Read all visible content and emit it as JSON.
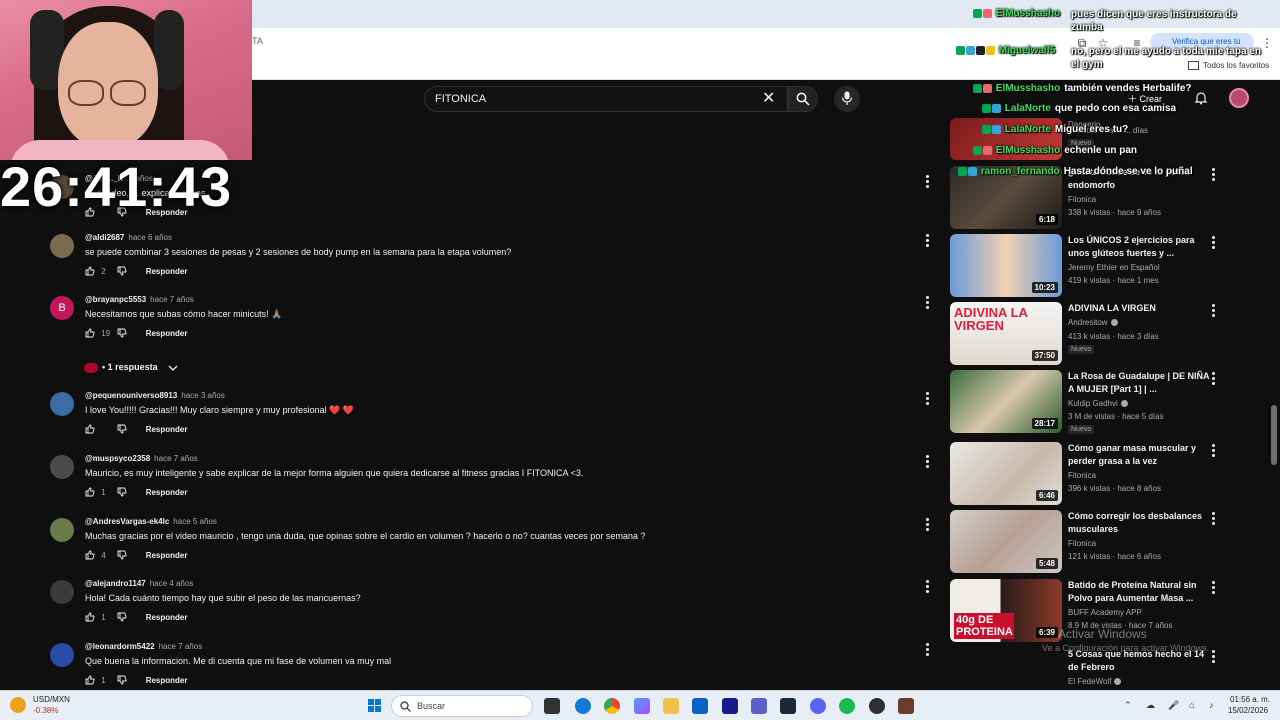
{
  "browser": {
    "address_fragment": "TA",
    "verify_label": "Verifica que eres tú",
    "bookmarks_label": "Todos los favoritos"
  },
  "youtube": {
    "search_value": "FITONICA",
    "create_label": "Crear"
  },
  "stream": {
    "timer": "26:41:43"
  },
  "comments": [
    {
      "user": "@Jos..._h",
      "time": "... años",
      "text": "Qué vídeo, ... explica ... cosas",
      "likes": "",
      "reply": "Responder"
    },
    {
      "user": "@aldi2687",
      "time": "hace 6 años",
      "text": "se puede combinar 3 sesiones de pesas y 2 sesiones de body pump en la semana para la etapa volumen?",
      "likes": "2",
      "reply": "Responder"
    },
    {
      "user": "@brayanpc5553",
      "time": "hace 7 años",
      "text": "Necesitamos que subas cómo hacer minicuts! 🙏🏽",
      "likes": "19",
      "reply": "Responder",
      "avatar_letter": "B"
    },
    {
      "user": "@pequenouniverso8913",
      "time": "hace 3 años",
      "text": "I love You!!!!! Gracias!!! Muy claro siempre y muy profesional ❤️ ❤️",
      "likes": "",
      "reply": "Responder"
    },
    {
      "user": "@muspsyco2358",
      "time": "hace 7 años",
      "text": "Mauricio, es muy inteligente y sabe explicar de la mejor forma alguien que quiera dedicarse al fitness gracias I FITONICA <3.",
      "likes": "1",
      "reply": "Responder"
    },
    {
      "user": "@AndresVargas-ek4lc",
      "time": "hace 5 años",
      "text": "Muchas gracias por el video mauricio , tengo una duda,  que opinas sobre el cardio en volumen ? hacerlo o no? cuantas veces por semana ?",
      "likes": "4",
      "reply": "Responder"
    },
    {
      "user": "@alejandro1147",
      "time": "hace 4 años",
      "text": "Hola! Cada cuánto tiempo hay que subir el peso de las mancuernas?",
      "likes": "1",
      "reply": "Responder"
    },
    {
      "user": "@leonardorm5422",
      "time": "hace 7 años",
      "text": "Que buena la informacion. Me di cuenta que mi fase de volumen va muy mal",
      "likes": "1",
      "reply": "Responder"
    }
  ],
  "replies_toggle": "• 1 respuesta",
  "sidebar_videos": [
    {
      "title": "Dangerio",
      "channel": "",
      "meta": "... vistas · hace ... días",
      "duration": "",
      "badge": "Nuevo"
    },
    {
      "title": "¿Hasta dónde se ve lo puñal endomorfo",
      "channel": "Fitonica",
      "meta": "338 k vistas · hace 9 años",
      "duration": "6:18",
      "badge": ""
    },
    {
      "title": "Los ÚNICOS 2 ejercicios para unos glúteos fuertes y ...",
      "channel": "Jeremy Ethier en Español",
      "meta": "419 k vistas · hace 1 mes",
      "duration": "10:23",
      "badge": ""
    },
    {
      "title": "ADIVINA LA VIRGEN",
      "channel": "Andresitow",
      "meta": "413 k vistas · hace 3 días",
      "duration": "37:50",
      "badge": "Nuevo",
      "thumb_text": "ADIVINA LA VIRGEN"
    },
    {
      "title": "La Rosa de Guadalupe | DE NIÑA A MUJER [Part 1] | ...",
      "channel": "Kuldip Gadhvi",
      "meta": "3 M de vistas · hace 5 días",
      "duration": "28:17",
      "badge": "Nuevo"
    },
    {
      "title": "Cómo ganar masa muscular y perder grasa a la vez",
      "channel": "Fitonica",
      "meta": "396 k vistas · hace 8 años",
      "duration": "6:46",
      "badge": ""
    },
    {
      "title": "Cómo corregir los desbalances musculares",
      "channel": "Fitonica",
      "meta": "121 k vistas · hace 6 años",
      "duration": "5:48",
      "badge": ""
    },
    {
      "title": "Batido de Proteína Natural sin Polvo para Aumentar Masa ...",
      "channel": "BUFF Academy APP",
      "meta": "8.9 M de vistas · hace 7 años",
      "duration": "6:39",
      "badge": "",
      "thumb_text": "40g DE PROTEINA"
    },
    {
      "title": "5 Cosas que hemos hecho el 14 de Febrero",
      "channel": "El FedeWolf",
      "meta": "",
      "duration": "",
      "badge": ""
    }
  ],
  "chat": [
    {
      "name": "ElMusshasho",
      "text": "pues dicen que eres instructora de zumba"
    },
    {
      "name": "Miguelwalf5",
      "text": "no, pero el me ayudo a toda mie tapa en el gym"
    },
    {
      "name": "ElMusshasho",
      "text": "también vendes Herbalife?"
    },
    {
      "name": "LalaNorte",
      "text": "que pedo con esa camisa"
    },
    {
      "name": "LalaNorte",
      "text": "Miguel eres tu?"
    },
    {
      "name": "ElMusshasho",
      "text": "echenle un pan"
    },
    {
      "name": "ramon_fernando",
      "text": "Hasta dónde se ve lo puñal"
    }
  ],
  "watermark": {
    "line1": "Activar Windows",
    "line2": "Ve a Configuración para activar Windows."
  },
  "taskbar": {
    "ticker_name": "USD/MXN",
    "ticker_change": "-0.38%",
    "search_placeholder": "Buscar",
    "time": "01:56 a. m.",
    "date": "15/02/2026"
  },
  "colors": {
    "chat_name": "#3de05a",
    "yt_bg": "#0f0f0f",
    "chrome_bg": "#e3e9f2"
  }
}
